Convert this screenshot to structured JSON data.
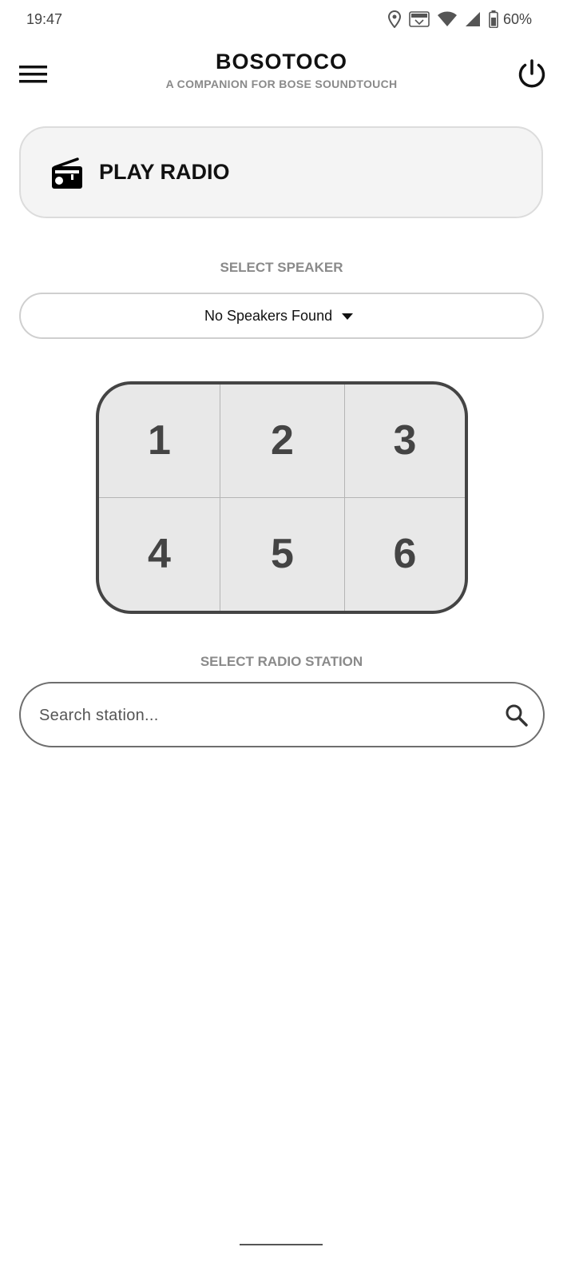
{
  "status_bar": {
    "time": "19:47",
    "battery": "60%",
    "icons": [
      "location-icon",
      "vowifi-icon",
      "wifi-icon",
      "signal-icon",
      "battery-icon"
    ]
  },
  "header": {
    "title": "BOSOTOCO",
    "subtitle": "A COMPANION FOR BOSE SOUNDTOUCH",
    "menu_icon": "hamburger-menu-icon",
    "power_icon": "power-icon"
  },
  "play_radio": {
    "label": "PLAY RADIO",
    "icon": "radio-icon"
  },
  "speaker": {
    "section_label": "SELECT SPEAKER",
    "selected": "No Speakers Found"
  },
  "presets": [
    "1",
    "2",
    "3",
    "4",
    "5",
    "6"
  ],
  "station": {
    "section_label": "SELECT RADIO STATION",
    "placeholder": "Search station...",
    "value": ""
  },
  "colors": {
    "preset_background": "#e8e8e8",
    "preset_border": "#444444",
    "play_radio_background": "#f4f4f4",
    "muted_label": "#8a8a8a"
  }
}
